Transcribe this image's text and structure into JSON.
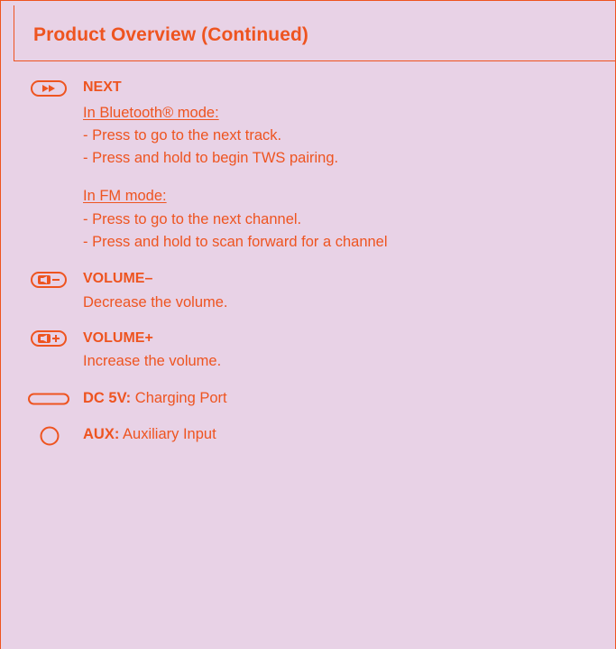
{
  "header": {
    "title": "Product Overview (Continued)"
  },
  "items": [
    {
      "icon": "fast-forward-icon",
      "label": "NEXT",
      "sections": [
        {
          "heading": "In Bluetooth® mode:",
          "lines": [
            "- Press to go to the next track.",
            "- Press and hold to begin TWS pairing."
          ]
        },
        {
          "heading": "In FM mode:",
          "lines": [
            "- Press to go to the next channel.",
            "- Press and hold to scan forward for a channel"
          ]
        }
      ]
    },
    {
      "icon": "volume-down-icon",
      "label": "VOLUME–",
      "description": "Decrease the volume."
    },
    {
      "icon": "volume-up-icon",
      "label": "VOLUME+",
      "description": "Increase the volume."
    },
    {
      "icon": "charging-port-icon",
      "label": "DC 5V:",
      "description": "Charging Port"
    },
    {
      "icon": "aux-input-icon",
      "label": "AUX:",
      "description": "Auxiliary Input"
    }
  ],
  "colors": {
    "accent": "#ee5420",
    "background": "#e8d2e6"
  }
}
